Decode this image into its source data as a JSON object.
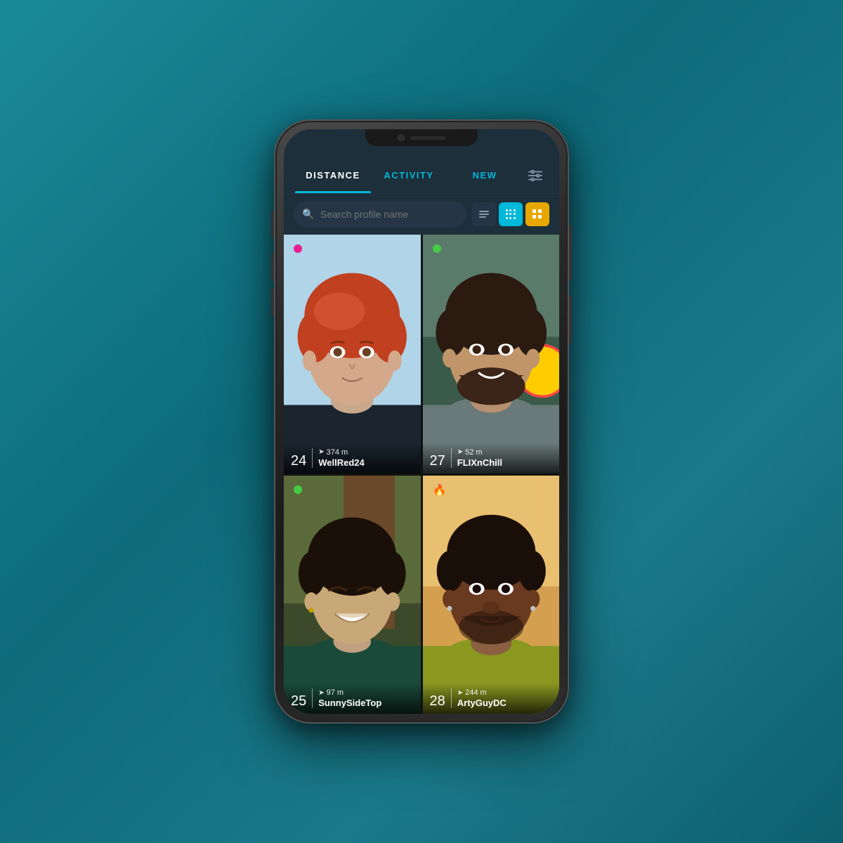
{
  "background": {
    "color": "#1a7a8a"
  },
  "phone": {
    "status_bar": ""
  },
  "tabs": [
    {
      "id": "distance",
      "label": "DISTANCE",
      "active": true
    },
    {
      "id": "activity",
      "label": "ACTIVITY",
      "active": false
    },
    {
      "id": "new",
      "label": "NEW",
      "active": false
    }
  ],
  "search": {
    "placeholder": "Search profile name"
  },
  "view_toggles": [
    {
      "id": "list",
      "type": "list",
      "label": "List view"
    },
    {
      "id": "grid-small",
      "type": "grid-small",
      "label": "Small grid view"
    },
    {
      "id": "grid-large",
      "type": "grid-large",
      "label": "Large grid view"
    }
  ],
  "profiles": [
    {
      "id": "profile-1",
      "age": "24",
      "distance": "374 m",
      "name": "WellRed24",
      "status": "pink",
      "position": "top-left"
    },
    {
      "id": "profile-2",
      "age": "27",
      "distance": "52 m",
      "name": "FLIXnChill",
      "status": "green",
      "position": "top-right"
    },
    {
      "id": "profile-3",
      "age": "25",
      "distance": "97 m",
      "name": "SunnySideTop",
      "status": "green",
      "position": "bottom-left"
    },
    {
      "id": "profile-4",
      "age": "28",
      "distance": "244 m",
      "name": "ArtyGuyDC",
      "status": "flame",
      "position": "bottom-right"
    }
  ],
  "icons": {
    "search": "🔍",
    "filter": "⚙",
    "arrow": "➤",
    "flame": "🔥"
  }
}
